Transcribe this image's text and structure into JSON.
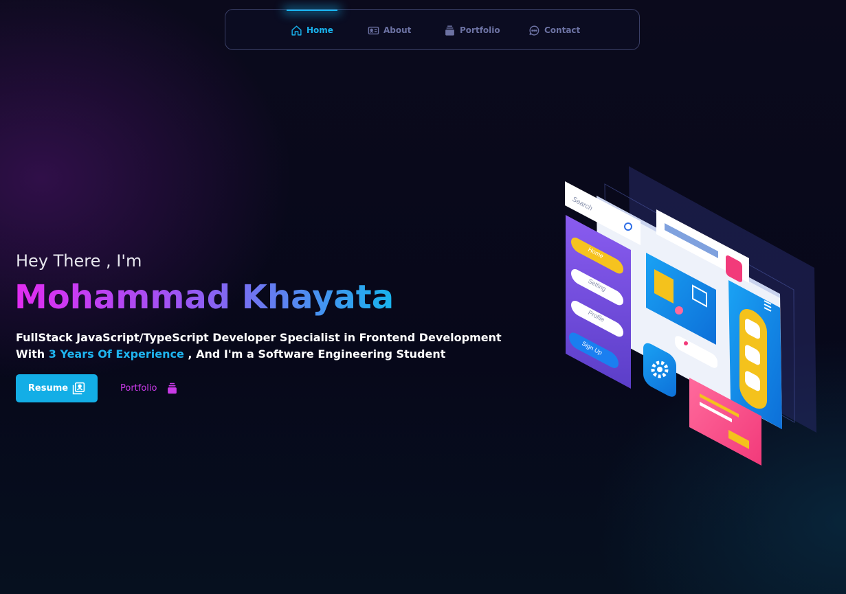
{
  "nav": {
    "items": [
      {
        "label": "Home",
        "icon": "home-icon",
        "active": true
      },
      {
        "label": "About",
        "icon": "id-card-icon",
        "active": false
      },
      {
        "label": "Portfolio",
        "icon": "stack-icon",
        "active": false
      },
      {
        "label": "Contact",
        "icon": "chat-icon",
        "active": false
      }
    ]
  },
  "hero": {
    "greeting": "Hey There , I'm",
    "name": "Mohammad Khayata",
    "tagline_line1": "FullStack JavaScript/TypeScript Developer Specialist in Frontend Development",
    "tagline_prefix": "With ",
    "tagline_highlight": "3 Years Of Experience",
    "tagline_suffix": " , And I'm a Software Engineering Student",
    "resume_label": "Resume",
    "portfolio_label": "Portfolio"
  },
  "illustration": {
    "search_placeholder": "Search",
    "menu_items": [
      "Home",
      "Setting",
      "Profile"
    ],
    "signup_label": "Sign Up"
  },
  "colors": {
    "accent": "#19b3ee",
    "gradient_start": "#e22cf1",
    "gradient_end": "#18b4ee",
    "portfolio_link": "#c83ae6"
  }
}
